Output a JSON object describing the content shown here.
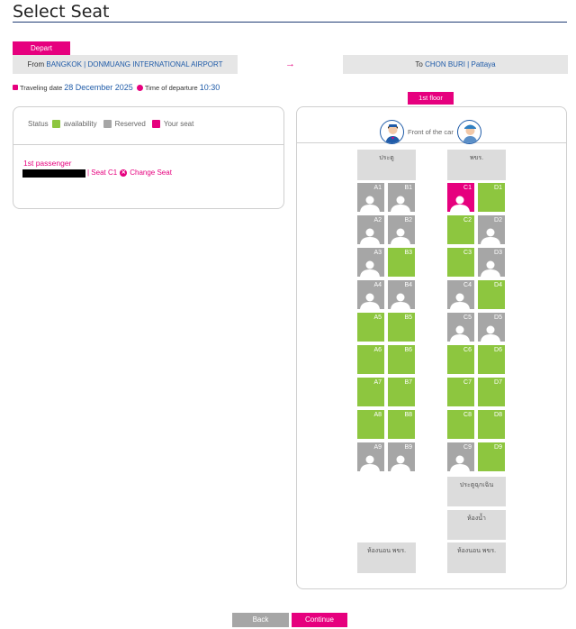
{
  "page": {
    "title": "Select Seat"
  },
  "colors": {
    "available": "#8dc63f",
    "reserved": "#a6a6a6",
    "your_seat": "#e6007e",
    "accent_blue": "#1f5ba8"
  },
  "trip": {
    "depart_tab": "Depart",
    "from_prefix": "From",
    "from_city": "BANGKOK | DONMUANG INTERNATIONAL AIRPORT",
    "to_prefix": "To",
    "to_city": "CHON BURI | Pattaya",
    "arrow": "→",
    "traveling_date_label": "Traveling date",
    "traveling_date": "28 December 2025",
    "departure_label": "Time of departure",
    "departure_time": "10:30"
  },
  "legend": {
    "status_label": "Status",
    "available": "availability",
    "reserved": "Reserved",
    "your_seat": "Your seat"
  },
  "passenger": {
    "label": "1st passenger",
    "seat_text": "| Seat C1",
    "change_seat": "Change Seat"
  },
  "bus": {
    "floor_tab": "1st floor",
    "front_label": "Front of the car",
    "door_label": "ประตู",
    "staff_label": "พขร.",
    "emergency_door": "ประตูฉุกเฉิน",
    "toilet": "ห้องน้ำ",
    "staff_rest": "ห้องนอน พขร."
  },
  "seats_left": [
    {
      "row": "1",
      "a": {
        "label": "A1",
        "status": "reserved"
      },
      "b": {
        "label": "B1",
        "status": "reserved"
      }
    },
    {
      "row": "2",
      "a": {
        "label": "A2",
        "status": "reserved"
      },
      "b": {
        "label": "B2",
        "status": "reserved"
      }
    },
    {
      "row": "3",
      "a": {
        "label": "A3",
        "status": "reserved"
      },
      "b": {
        "label": "B3",
        "status": "available"
      }
    },
    {
      "row": "4",
      "a": {
        "label": "A4",
        "status": "reserved"
      },
      "b": {
        "label": "B4",
        "status": "reserved"
      }
    },
    {
      "row": "5",
      "a": {
        "label": "A5",
        "status": "available"
      },
      "b": {
        "label": "B5",
        "status": "available"
      }
    },
    {
      "row": "6",
      "a": {
        "label": "A6",
        "status": "available"
      },
      "b": {
        "label": "B6",
        "status": "available"
      }
    },
    {
      "row": "7",
      "a": {
        "label": "A7",
        "status": "available"
      },
      "b": {
        "label": "B7",
        "status": "available"
      }
    },
    {
      "row": "8",
      "a": {
        "label": "A8",
        "status": "available"
      },
      "b": {
        "label": "B8",
        "status": "available"
      }
    },
    {
      "row": "9",
      "a": {
        "label": "A9",
        "status": "reserved"
      },
      "b": {
        "label": "B9",
        "status": "reserved"
      }
    }
  ],
  "seats_right": [
    {
      "row": "1",
      "c": {
        "label": "C1",
        "status": "your_seat"
      },
      "d": {
        "label": "D1",
        "status": "available"
      }
    },
    {
      "row": "2",
      "c": {
        "label": "C2",
        "status": "available"
      },
      "d": {
        "label": "D2",
        "status": "reserved"
      }
    },
    {
      "row": "3",
      "c": {
        "label": "C3",
        "status": "available"
      },
      "d": {
        "label": "D3",
        "status": "reserved"
      }
    },
    {
      "row": "4",
      "c": {
        "label": "C4",
        "status": "reserved"
      },
      "d": {
        "label": "D4",
        "status": "available"
      }
    },
    {
      "row": "5",
      "c": {
        "label": "C5",
        "status": "reserved"
      },
      "d": {
        "label": "D5",
        "status": "reserved"
      }
    },
    {
      "row": "6",
      "c": {
        "label": "C6",
        "status": "available"
      },
      "d": {
        "label": "D6",
        "status": "available"
      }
    },
    {
      "row": "7",
      "c": {
        "label": "C7",
        "status": "available"
      },
      "d": {
        "label": "D7",
        "status": "available"
      }
    },
    {
      "row": "8",
      "c": {
        "label": "C8",
        "status": "available"
      },
      "d": {
        "label": "D8",
        "status": "available"
      }
    },
    {
      "row": "9",
      "c": {
        "label": "C9",
        "status": "reserved"
      },
      "d": {
        "label": "D9",
        "status": "available"
      }
    }
  ],
  "buttons": {
    "back": "Back",
    "continue": "Continue"
  }
}
